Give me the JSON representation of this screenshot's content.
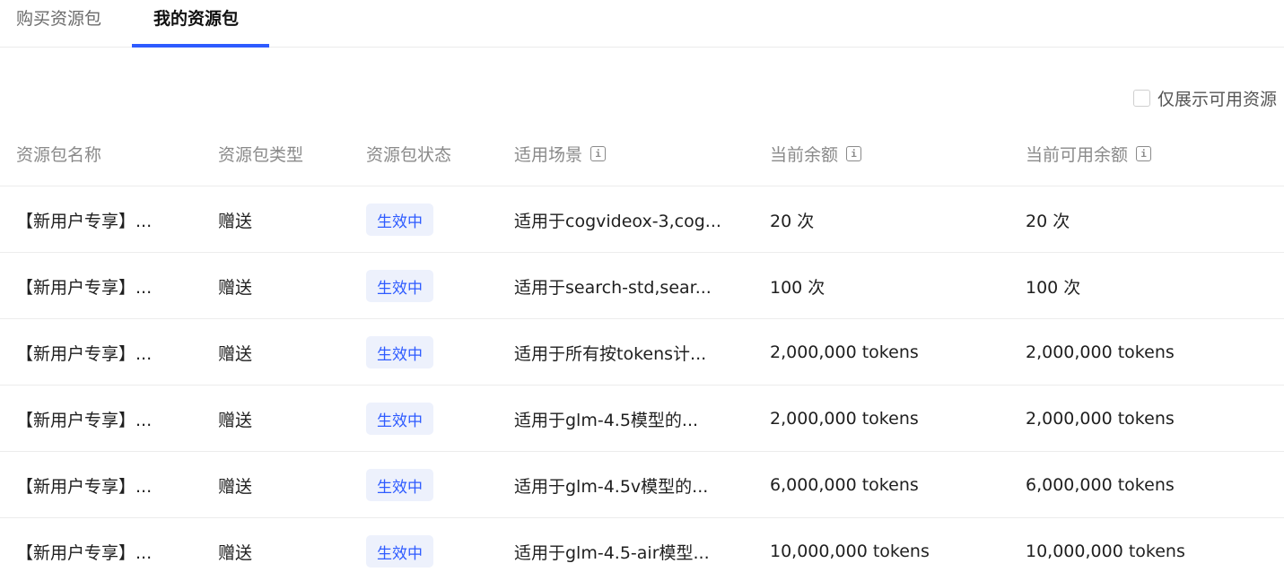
{
  "tabs": [
    {
      "label": "购买资源包",
      "active": false
    },
    {
      "label": "我的资源包",
      "active": true
    }
  ],
  "filter": {
    "label": "仅展示可用资源",
    "checked": false
  },
  "table": {
    "headers": [
      "资源包名称",
      "资源包类型",
      "资源包状态",
      "适用场景",
      "当前余额",
      "当前可用余额"
    ],
    "info_icon": "info-icon",
    "rows": [
      {
        "name": "【新用户专享】...",
        "type": "赠送",
        "status": "生效中",
        "scene": "适用于cogvideox-3,cog...",
        "balance": "20 次",
        "available": "20 次"
      },
      {
        "name": "【新用户专享】...",
        "type": "赠送",
        "status": "生效中",
        "scene": "适用于search-std,sear...",
        "balance": "100 次",
        "available": "100 次"
      },
      {
        "name": "【新用户专享】...",
        "type": "赠送",
        "status": "生效中",
        "scene": "适用于所有按tokens计...",
        "balance": "2,000,000 tokens",
        "available": "2,000,000 tokens"
      },
      {
        "name": "【新用户专享】...",
        "type": "赠送",
        "status": "生效中",
        "scene": "适用于glm-4.5模型的...",
        "balance": "2,000,000 tokens",
        "available": "2,000,000 tokens"
      },
      {
        "name": "【新用户专享】...",
        "type": "赠送",
        "status": "生效中",
        "scene": "适用于glm-4.5v模型的...",
        "balance": "6,000,000 tokens",
        "available": "6,000,000 tokens"
      },
      {
        "name": "【新用户专享】...",
        "type": "赠送",
        "status": "生效中",
        "scene": "适用于glm-4.5-air模型...",
        "balance": "10,000,000 tokens",
        "available": "10,000,000 tokens"
      }
    ]
  },
  "colors": {
    "accent": "#2e5bff",
    "badge_bg": "#edf1fc"
  }
}
